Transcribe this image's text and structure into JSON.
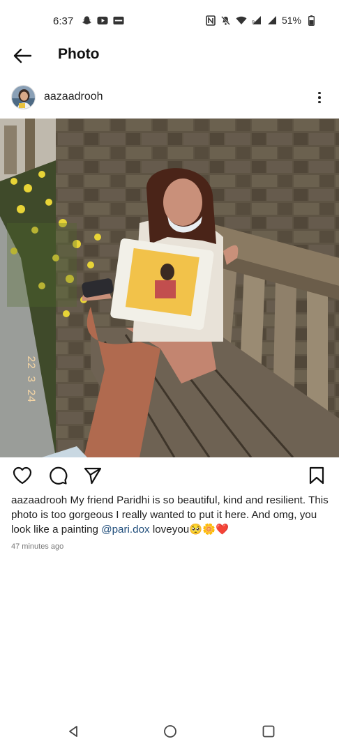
{
  "status_bar": {
    "time": "6:37",
    "battery": "51%",
    "left_icons": [
      "snapchat-icon",
      "youtube-icon",
      "paytm-icon"
    ],
    "right_icons": [
      "nfc-icon",
      "mute-icon",
      "wifi-icon",
      "signal-icon",
      "signal-icon",
      "battery-icon"
    ]
  },
  "header": {
    "title": "Photo"
  },
  "post": {
    "username": "aazaadrooh",
    "caption_user": "aazaadrooh",
    "caption_text": " My friend Paridhi is so beautiful, kind and resilient. This photo is too gorgeous I really wanted to put it here. And omg, you look like a painting ",
    "mention": "@pari.dox",
    "caption_tail": " loveyou",
    "emojis": "🥺🌼❤️",
    "timestamp": "47 minutes ago",
    "photo_date_stamp": "22 3 24"
  },
  "nav": {
    "back": "back-triangle",
    "home": "home-circle",
    "recents": "recents-square"
  }
}
